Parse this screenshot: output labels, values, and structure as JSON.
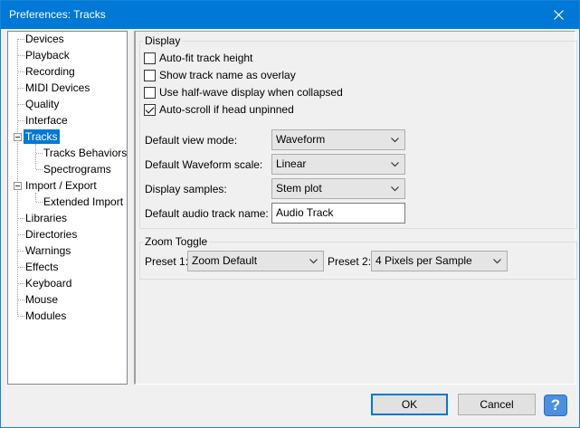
{
  "window": {
    "title": "Preferences: Tracks"
  },
  "tree": {
    "items": [
      {
        "label": "Devices"
      },
      {
        "label": "Playback"
      },
      {
        "label": "Recording"
      },
      {
        "label": "MIDI Devices"
      },
      {
        "label": "Quality"
      },
      {
        "label": "Interface"
      },
      {
        "label": "Tracks",
        "selected": true
      },
      {
        "label": "Tracks Behaviors"
      },
      {
        "label": "Spectrograms"
      },
      {
        "label": "Import / Export"
      },
      {
        "label": "Extended Import"
      },
      {
        "label": "Libraries"
      },
      {
        "label": "Directories"
      },
      {
        "label": "Warnings"
      },
      {
        "label": "Effects"
      },
      {
        "label": "Keyboard"
      },
      {
        "label": "Mouse"
      },
      {
        "label": "Modules"
      }
    ]
  },
  "display": {
    "title": "Display",
    "checkboxes": [
      {
        "label": "Auto-fit track height",
        "checked": false
      },
      {
        "label": "Show track name as overlay",
        "checked": false
      },
      {
        "label": "Use half-wave display when collapsed",
        "checked": false
      },
      {
        "label": "Auto-scroll if head unpinned",
        "checked": true
      }
    ],
    "view_mode": {
      "label": "Default view mode:",
      "value": "Waveform"
    },
    "waveform_scale": {
      "label": "Default Waveform scale:",
      "value": "Linear"
    },
    "display_samples": {
      "label": "Display samples:",
      "value": "Stem plot"
    },
    "track_name": {
      "label": "Default audio track name:",
      "value": "Audio Track"
    }
  },
  "zoom": {
    "title": "Zoom Toggle",
    "preset1": {
      "label": "Preset 1:",
      "value": "Zoom Default"
    },
    "preset2": {
      "label": "Preset 2:",
      "value": "4 Pixels per Sample"
    }
  },
  "buttons": {
    "ok": "OK",
    "cancel": "Cancel",
    "help": "?"
  }
}
